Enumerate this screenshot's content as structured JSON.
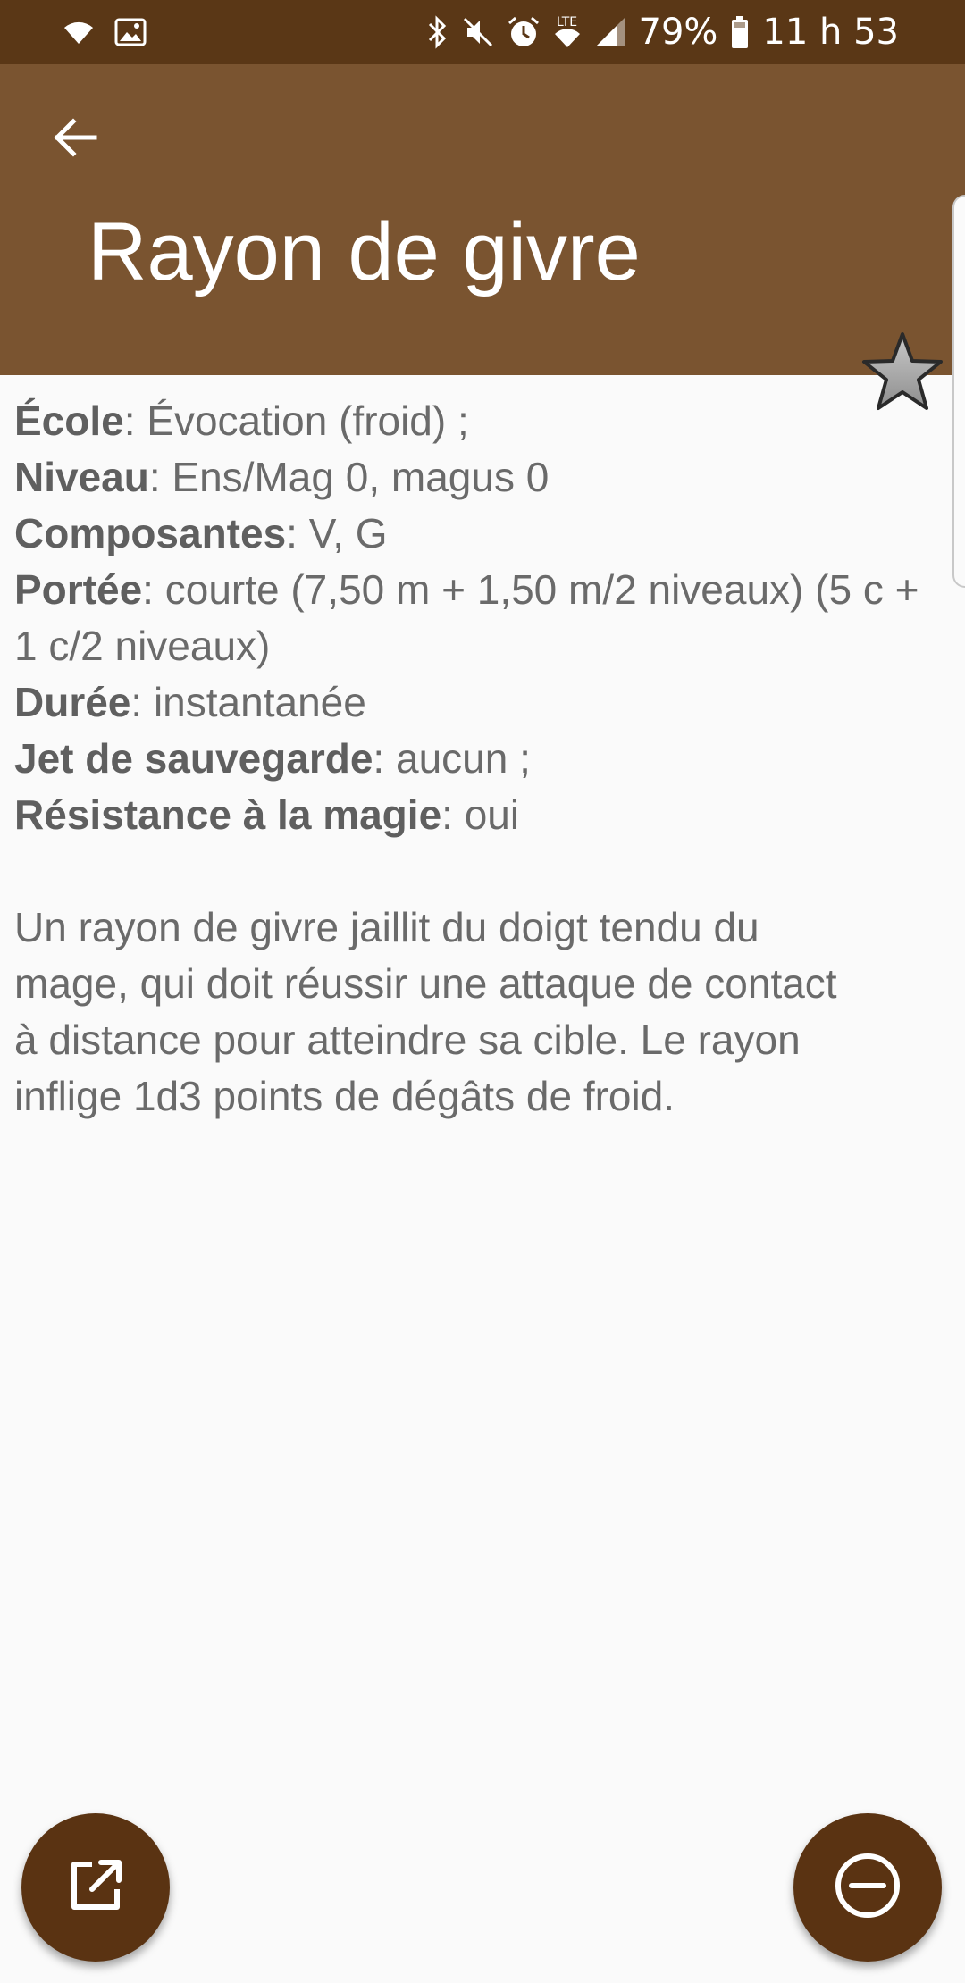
{
  "status_bar": {
    "network_label": "LTE",
    "battery_percent": "79%",
    "time": "11 h 53",
    "icons": [
      "wifi-icon",
      "image-icon",
      "bluetooth-icon",
      "mute-icon",
      "alarm-icon",
      "lte-wifi-icon",
      "signal-icon",
      "battery-icon"
    ]
  },
  "app_bar": {
    "title": "Rayon de givre",
    "back_icon": "arrow-left-icon"
  },
  "spell": {
    "school": {
      "label": "École",
      "value": ": Évocation (froid) ;"
    },
    "level": {
      "label": "Niveau",
      "value": ": Ens/Mag 0, magus 0"
    },
    "components": {
      "label": "Composantes",
      "value": ": V, G"
    },
    "range": {
      "label": "Portée",
      "value": ": courte (7,50 m + 1,50 m/2 niveaux) (5 c + 1 c/2 niveaux)"
    },
    "duration": {
      "label": "Durée",
      "value": ": instantanée"
    },
    "saving_throw": {
      "label": "Jet de sauvegarde",
      "value": ": aucun ;"
    },
    "spell_resistance": {
      "label": "Résistance à la magie",
      "value": ": oui"
    },
    "description": "Un rayon de givre jaillit du doigt tendu du mage, qui doit réussir une attaque de contact à distance pour atteindre sa cible. Le rayon inflige 1d3 points de dégâts de froid."
  },
  "actions": {
    "favorite_icon": "star-icon",
    "open_external_icon": "open-in-new-icon",
    "remove_icon": "minus-circle-icon"
  },
  "colors": {
    "status_bar": "#5a3716",
    "app_bar": "#7a5430",
    "fab": "#5a3312",
    "text": "#6a6a6a",
    "background": "#fafafa"
  }
}
